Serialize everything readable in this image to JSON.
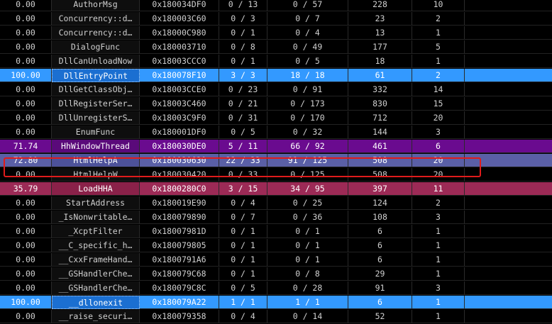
{
  "rows": [
    {
      "score": "0.00",
      "name": "AuthorMsg",
      "address": "0x180034DF0",
      "blocks": "0 / 13",
      "instrs": "0 / 57",
      "size": "228",
      "xrefs": "10",
      "highlight": "none"
    },
    {
      "score": "0.00",
      "name": "Concurrency::d…",
      "address": "0x180003C60",
      "blocks": "0 / 3",
      "instrs": "0 / 7",
      "size": "23",
      "xrefs": "2",
      "highlight": "none"
    },
    {
      "score": "0.00",
      "name": "Concurrency::d…",
      "address": "0x18000C980",
      "blocks": "0 / 1",
      "instrs": "0 / 4",
      "size": "13",
      "xrefs": "1",
      "highlight": "none"
    },
    {
      "score": "0.00",
      "name": "DialogFunc",
      "address": "0x180003710",
      "blocks": "0 / 8",
      "instrs": "0 / 49",
      "size": "177",
      "xrefs": "5",
      "highlight": "none"
    },
    {
      "score": "0.00",
      "name": "DllCanUnloadNow",
      "address": "0x18003CCC0",
      "blocks": "0 / 1",
      "instrs": "0 / 5",
      "size": "18",
      "xrefs": "1",
      "highlight": "none"
    },
    {
      "score": "100.00",
      "name": "DllEntryPoint",
      "address": "0x180078F10",
      "blocks": "3 / 3",
      "instrs": "18 / 18",
      "size": "61",
      "xrefs": "2",
      "highlight": "blue"
    },
    {
      "score": "0.00",
      "name": "DllGetClassObj…",
      "address": "0x18003CCE0",
      "blocks": "0 / 23",
      "instrs": "0 / 91",
      "size": "332",
      "xrefs": "14",
      "highlight": "none"
    },
    {
      "score": "0.00",
      "name": "DllRegisterSer…",
      "address": "0x18003C460",
      "blocks": "0 / 21",
      "instrs": "0 / 173",
      "size": "830",
      "xrefs": "15",
      "highlight": "none"
    },
    {
      "score": "0.00",
      "name": "DllUnregisterS…",
      "address": "0x18003C9F0",
      "blocks": "0 / 31",
      "instrs": "0 / 170",
      "size": "712",
      "xrefs": "20",
      "highlight": "none"
    },
    {
      "score": "0.00",
      "name": "EnumFunc",
      "address": "0x180001DF0",
      "blocks": "0 / 5",
      "instrs": "0 / 32",
      "size": "144",
      "xrefs": "3",
      "highlight": "none"
    },
    {
      "score": "71.74",
      "name": "HhWindowThread",
      "address": "0x180030DE0",
      "blocks": "5 / 11",
      "instrs": "66 / 92",
      "size": "461",
      "xrefs": "6",
      "highlight": "purple"
    },
    {
      "score": "72.80",
      "name": "HtmlHelpA",
      "address": "0x180030630",
      "blocks": "22 / 33",
      "instrs": "91 / 125",
      "size": "508",
      "xrefs": "20",
      "highlight": "slate"
    },
    {
      "score": "0.00",
      "name": "HtmlHelpW",
      "address": "0x180030420",
      "blocks": "0 / 33",
      "instrs": "0 / 125",
      "size": "508",
      "xrefs": "20",
      "highlight": "none"
    },
    {
      "score": "35.79",
      "name": "LoadHHA",
      "address": "0x1800280C0",
      "blocks": "3 / 15",
      "instrs": "34 / 95",
      "size": "397",
      "xrefs": "11",
      "highlight": "crimson"
    },
    {
      "score": "0.00",
      "name": "StartAddress",
      "address": "0x180019E90",
      "blocks": "0 / 4",
      "instrs": "0 / 25",
      "size": "124",
      "xrefs": "2",
      "highlight": "none"
    },
    {
      "score": "0.00",
      "name": "_IsNonwritable…",
      "address": "0x180079890",
      "blocks": "0 / 7",
      "instrs": "0 / 36",
      "size": "108",
      "xrefs": "3",
      "highlight": "none"
    },
    {
      "score": "0.00",
      "name": "_XcptFilter",
      "address": "0x18007981D",
      "blocks": "0 / 1",
      "instrs": "0 / 1",
      "size": "6",
      "xrefs": "1",
      "highlight": "none"
    },
    {
      "score": "0.00",
      "name": "__C_specific_h…",
      "address": "0x180079805",
      "blocks": "0 / 1",
      "instrs": "0 / 1",
      "size": "6",
      "xrefs": "1",
      "highlight": "none"
    },
    {
      "score": "0.00",
      "name": "__CxxFrameHand…",
      "address": "0x1800791A6",
      "blocks": "0 / 1",
      "instrs": "0 / 1",
      "size": "6",
      "xrefs": "1",
      "highlight": "none"
    },
    {
      "score": "0.00",
      "name": "__GSHandlerChe…",
      "address": "0x180079C68",
      "blocks": "0 / 1",
      "instrs": "0 / 8",
      "size": "29",
      "xrefs": "1",
      "highlight": "none"
    },
    {
      "score": "0.00",
      "name": "__GSHandlerChe…",
      "address": "0x180079C8C",
      "blocks": "0 / 5",
      "instrs": "0 / 28",
      "size": "91",
      "xrefs": "3",
      "highlight": "none"
    },
    {
      "score": "100.00",
      "name": "__dllonexit",
      "address": "0x180079A22",
      "blocks": "1 / 1",
      "instrs": "1 / 1",
      "size": "6",
      "xrefs": "1",
      "highlight": "blue"
    },
    {
      "score": "0.00",
      "name": "__raise_securi…",
      "address": "0x180079358",
      "blocks": "0 / 4",
      "instrs": "0 / 14",
      "size": "52",
      "xrefs": "1",
      "highlight": "none"
    }
  ],
  "selected_row": "HtmlHelpA",
  "colors": {
    "blue": "#3399ff",
    "purple": "#6a0b8f",
    "slate": "#5a5fa6",
    "crimson": "#9c2a56",
    "selection_outline": "#e01b1b"
  }
}
